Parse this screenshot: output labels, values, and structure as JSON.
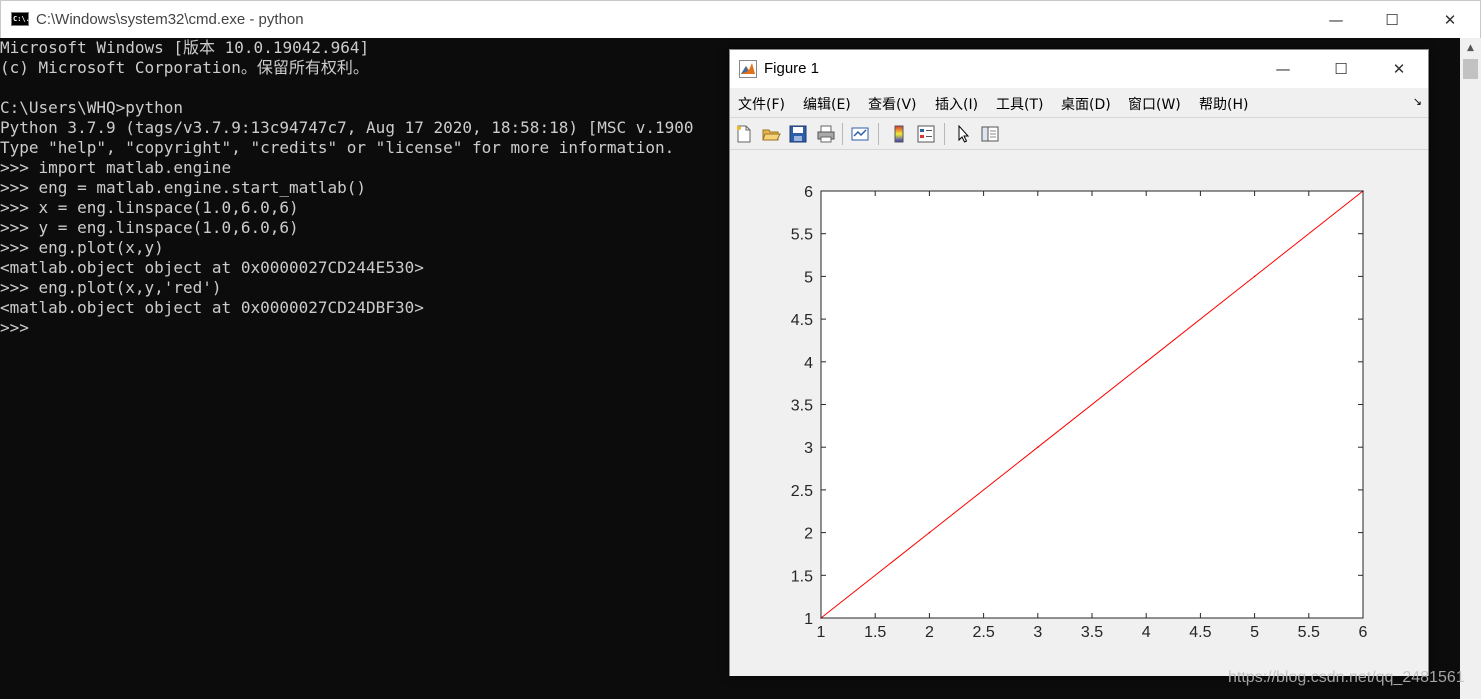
{
  "cmd": {
    "title": "C:\\Windows\\system32\\cmd.exe - python",
    "icon": "cmd-icon",
    "icon_text": "C:\\.",
    "lines": [
      "Microsoft Windows [版本 10.0.19042.964]",
      "(c) Microsoft Corporation。保留所有权利。",
      "",
      "C:\\Users\\WHQ>python",
      "Python 3.7.9 (tags/v3.7.9:13c94747c7, Aug 17 2020, 18:58:18) [MSC v.1900",
      "Type \"help\", \"copyright\", \"credits\" or \"license\" for more information.",
      ">>> import matlab.engine",
      ">>> eng = matlab.engine.start_matlab()",
      ">>> x = eng.linspace(1.0,6.0,6)",
      ">>> y = eng.linspace(1.0,6.0,6)",
      ">>> eng.plot(x,y)",
      "<matlab.object object at 0x0000027CD244E530>",
      ">>> eng.plot(x,y,'red')",
      "<matlab.object object at 0x0000027CD24DBF30>",
      ">>>"
    ],
    "controls": {
      "minimize": "—",
      "maximize": "☐",
      "close": "✕"
    }
  },
  "figure": {
    "title": "Figure 1",
    "controls": {
      "minimize": "—",
      "maximize": "☐",
      "close": "✕"
    },
    "menu": [
      "文件(F)",
      "编辑(E)",
      "查看(V)",
      "插入(I)",
      "工具(T)",
      "桌面(D)",
      "窗口(W)",
      "帮助(H)"
    ],
    "menu_more": "↘",
    "toolbar": [
      "new-figure-icon",
      "open-file-icon",
      "save-icon",
      "print-icon",
      "link-plot-icon",
      "colorbar-icon",
      "legend-icon",
      "pointer-icon",
      "property-editor-icon"
    ]
  },
  "chart_data": {
    "type": "line",
    "x": [
      1,
      2,
      3,
      4,
      5,
      6
    ],
    "series": [
      {
        "values": [
          1,
          2,
          3,
          4,
          5,
          6
        ],
        "color": "#ff0000"
      }
    ],
    "xlim": [
      1,
      6
    ],
    "ylim": [
      1,
      6
    ],
    "xticks": [
      "1",
      "1.5",
      "2",
      "2.5",
      "3",
      "3.5",
      "4",
      "4.5",
      "5",
      "5.5",
      "6"
    ],
    "yticks": [
      "1",
      "1.5",
      "2",
      "2.5",
      "3",
      "3.5",
      "4",
      "4.5",
      "5",
      "5.5",
      "6"
    ],
    "title": "",
    "xlabel": "",
    "ylabel": "",
    "grid": false
  },
  "watermark": "https://blog.csdn.net/qq_2481561"
}
